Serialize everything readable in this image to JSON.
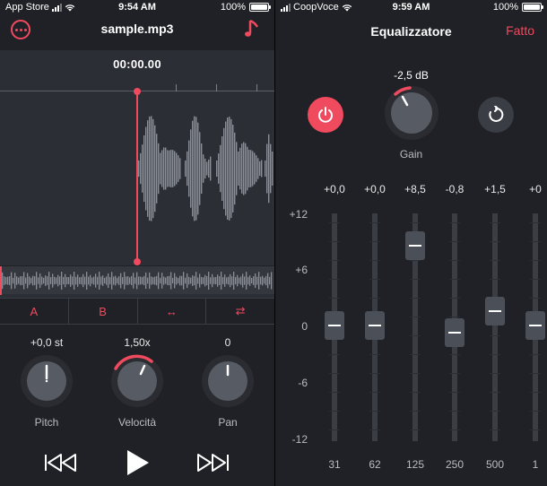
{
  "left": {
    "status": {
      "carrier": "App Store",
      "time": "9:54 AM",
      "battery": "100%"
    },
    "title": "sample.mp3",
    "time_display": "00:00.00",
    "ab_buttons": [
      "A",
      "B",
      "↔",
      "⇄"
    ],
    "knobs": [
      {
        "label": "Pitch",
        "value": "+0,0 st",
        "level": 0.5
      },
      {
        "label": "Velocità",
        "value": "1,50x",
        "level": 0.62
      },
      {
        "label": "Pan",
        "value": "0",
        "level": 0.5
      }
    ],
    "transport": {
      "prev": "rewind-icon",
      "play": "play-icon",
      "next": "fast-forward-icon"
    }
  },
  "right": {
    "status": {
      "carrier": "CoopVoce",
      "time": "9:59 AM",
      "battery": "100%"
    },
    "title": "Equalizzatore",
    "done_label": "Fatto",
    "gain_value": "-2,5 dB",
    "gain_label": "Gain",
    "db_scale": [
      "+12",
      "+6",
      "0",
      "-6",
      "-12"
    ],
    "bands": [
      {
        "freq": "31",
        "value": "+0,0",
        "db": 0.0
      },
      {
        "freq": "62",
        "value": "+0,0",
        "db": 0.0
      },
      {
        "freq": "125",
        "value": "+8,5",
        "db": 8.5
      },
      {
        "freq": "250",
        "value": "-0,8",
        "db": -0.8
      },
      {
        "freq": "500",
        "value": "+1,5",
        "db": 1.5
      },
      {
        "freq": "1",
        "value": "+0",
        "db": 0.0
      }
    ],
    "colors": {
      "accent": "#f04a5f",
      "background": "#1f2126",
      "panel": "#2b2e35"
    }
  }
}
